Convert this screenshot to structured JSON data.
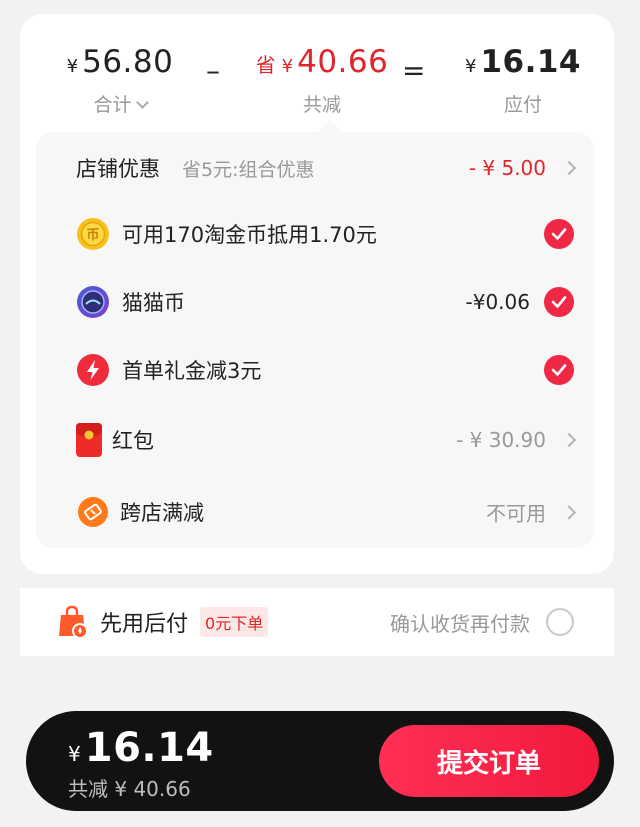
{
  "summary": {
    "total": {
      "currency": "¥",
      "amount": "56.80",
      "label": "合计"
    },
    "minus_op": "–",
    "savings": {
      "save_word": "省",
      "currency": "¥",
      "amount": "40.66",
      "label": "共减"
    },
    "equals_op": "=",
    "payable": {
      "currency": "¥",
      "amount": "16.14",
      "label": "应付"
    }
  },
  "discounts": {
    "shop": {
      "label": "店铺优惠",
      "desc": "省5元:组合优惠",
      "value": "- ¥ 5.00"
    },
    "coins": {
      "label": "可用170淘金币抵用1.70元",
      "checked": true,
      "icon": "gold-coin-icon"
    },
    "cat_coins": {
      "label": "猫猫币",
      "value": "-¥0.06",
      "checked": true,
      "icon": "cat-coin-icon"
    },
    "first_order": {
      "label": "首单礼金减3元",
      "checked": true,
      "icon": "lightning-icon"
    },
    "red_packet": {
      "label": "红包",
      "value": "- ¥ 30.90",
      "icon": "red-packet-icon"
    },
    "cross_store": {
      "label": "跨店满减",
      "value": "不可用",
      "icon": "ticket-icon"
    }
  },
  "pay_later": {
    "label": "先用后付",
    "tag": "0元下单",
    "confirm_text": "确认收货再付款",
    "selected": false
  },
  "footer": {
    "currency": "¥",
    "total": "16.14",
    "saved_text": "共减 ¥ 40.66",
    "submit_label": "提交订单"
  },
  "colors": {
    "accent_red": "#e0262b",
    "check_red": "#ef2845",
    "bar_black": "#121212"
  }
}
